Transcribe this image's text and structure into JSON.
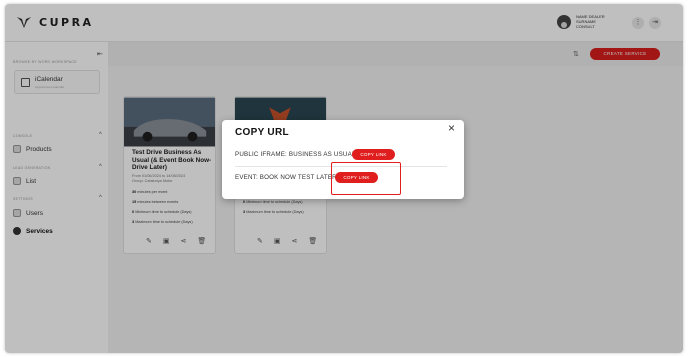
{
  "header": {
    "brand": "CUPRA",
    "user_name": "NAME DEALER",
    "user_surname": "SURNAME",
    "user_role": "CONSULT"
  },
  "sidebar": {
    "section_label": "BROWSE BY WORD WORKSPACE",
    "calendar_title": "iCalendar",
    "calendar_subtitle": "Appointment calendar",
    "products_section": "CONSOLE",
    "products_label": "Products",
    "list_section": "LEAD GENERATION",
    "list_label": "List",
    "settings_section": "SETTINGS",
    "users_label": "Users",
    "services_label": "Services"
  },
  "toolbar": {
    "create_label": "CREATE SERVICE"
  },
  "cards": [
    {
      "title": "Test Drive Business As Usual (& Event Book Now-Drive Later)",
      "dates": "From 01/06/2024 to 14/08/2024",
      "dealer": "Group: Catalunya Motor",
      "stats": [
        {
          "value": "30",
          "text": "minutes per event"
        },
        {
          "value": "15",
          "text": "minutes between events"
        },
        {
          "value": "0",
          "text": "Minimum time to schedule (Days)"
        },
        {
          "value": "3",
          "text": "Maximum time to schedule (Days)"
        }
      ]
    },
    {
      "stats": [
        {
          "value": "0",
          "text": "Minimum time to schedule (Days)"
        },
        {
          "value": "3",
          "text": "Maximum time to schedule (Days)"
        }
      ]
    }
  ],
  "dialog": {
    "title": "COPY URL",
    "close_symbol": "×",
    "row1_label": "PUBLIC IFRAME: BUSINESS AS USUAL",
    "row1_button": "COPY LINK",
    "row2_label": "EVENT: BOOK NOW TEST LATER",
    "row2_button": "COPY LINK"
  },
  "colors": {
    "accent": "#e01e1e",
    "overlay": "rgba(0,0,0,0.25)"
  }
}
